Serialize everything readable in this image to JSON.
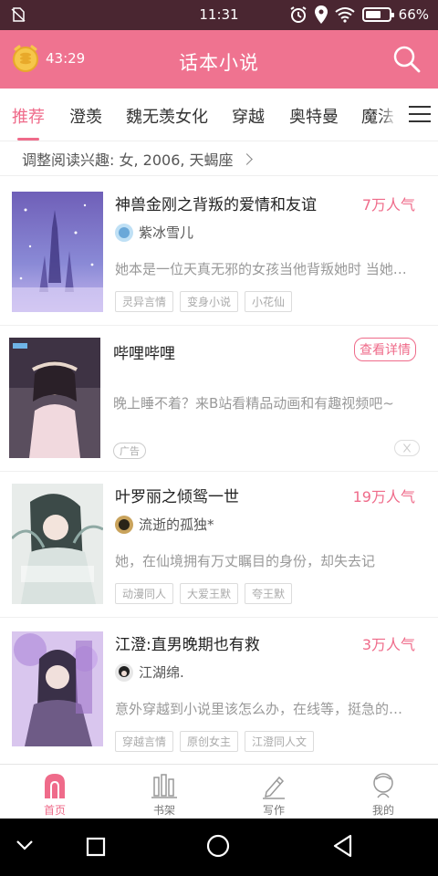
{
  "status_bar": {
    "time": "11:31",
    "battery_percent": "66%",
    "battery_level": 0.66,
    "icons": [
      "no-sim-icon",
      "alarm-icon",
      "location-icon",
      "wifi-icon",
      "battery-icon"
    ]
  },
  "app_bar": {
    "timer": "43:29",
    "title": "话本小说",
    "icons": [
      "coin-timer-icon",
      "search-icon"
    ]
  },
  "tabs": [
    {
      "label": "推荐",
      "active": true
    },
    {
      "label": "澄羡",
      "active": false
    },
    {
      "label": "魏无羡女化",
      "active": false
    },
    {
      "label": "穿越",
      "active": false
    },
    {
      "label": "奥特曼",
      "active": false
    },
    {
      "label": "魔法",
      "active": false
    }
  ],
  "interest": {
    "label": "调整阅读兴趣: 女, 2006, 天蝎座"
  },
  "books": [
    {
      "title": "神兽金刚之背叛的爱情和友谊",
      "popularity": "7万人气",
      "author": "紫冰雪儿",
      "description": "她本是一位天真无邪的女孩当他背叛她时 当她…",
      "tags": [
        "灵异言情",
        "变身小说",
        "小花仙"
      ]
    },
    {
      "title": "叶罗丽之倾鸳一世",
      "popularity": "19万人气",
      "author": "流逝的孤独*",
      "description": "她，在仙境拥有万丈瞩目的身份，却失去记",
      "tags": [
        "动漫同人",
        "大爱王默",
        "夸王默"
      ]
    },
    {
      "title": "江澄:直男晚期也有救",
      "popularity": "3万人气",
      "author": "江湖绵.",
      "description": "意外穿越到小说里该怎么办，在线等，挺急的…",
      "tags": [
        "穿越言情",
        "原创女主",
        "江澄同人文"
      ]
    }
  ],
  "ad": {
    "title": "哔哩哔哩",
    "button": "查看详情",
    "description": "晚上睡不着？来B站看精品动画和有趣视频吧~",
    "badge": "广告"
  },
  "bottom_nav": [
    {
      "label": "首页",
      "icon": "home-icon",
      "active": true
    },
    {
      "label": "书架",
      "icon": "bookshelf-icon",
      "active": false
    },
    {
      "label": "写作",
      "icon": "pencil-icon",
      "active": false
    },
    {
      "label": "我的",
      "icon": "profile-icon",
      "active": false
    }
  ],
  "colors": {
    "accent": "#ef6b8a",
    "app_bar": "#ef7390",
    "status_bar": "#4a2631"
  }
}
